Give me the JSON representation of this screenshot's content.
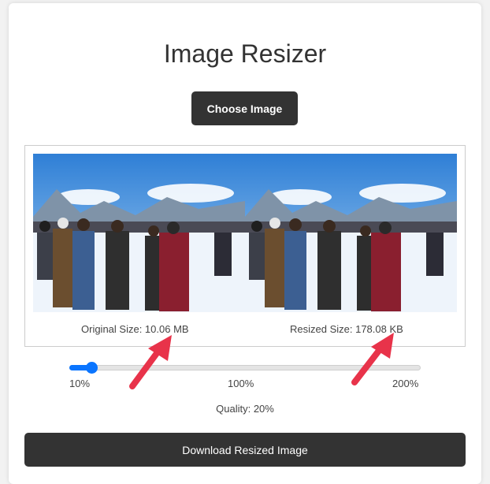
{
  "app": {
    "title": "Image Resizer"
  },
  "controls": {
    "choose_label": "Choose Image",
    "download_label": "Download Resized Image"
  },
  "preview": {
    "original_label": "Original Size: 10.06 MB",
    "resized_label": "Resized Size: 178.08 KB"
  },
  "slider": {
    "min_label": "10%",
    "mid_label": "100%",
    "max_label": "200%",
    "min": 10,
    "max": 200,
    "value": 20,
    "accent_color": "#0a75ff"
  },
  "quality_label": "Quality: 20%",
  "icons": {
    "annotation": "arrow-icon"
  },
  "colors": {
    "button_bg": "#333333",
    "arrow_red": "#e8334a"
  }
}
